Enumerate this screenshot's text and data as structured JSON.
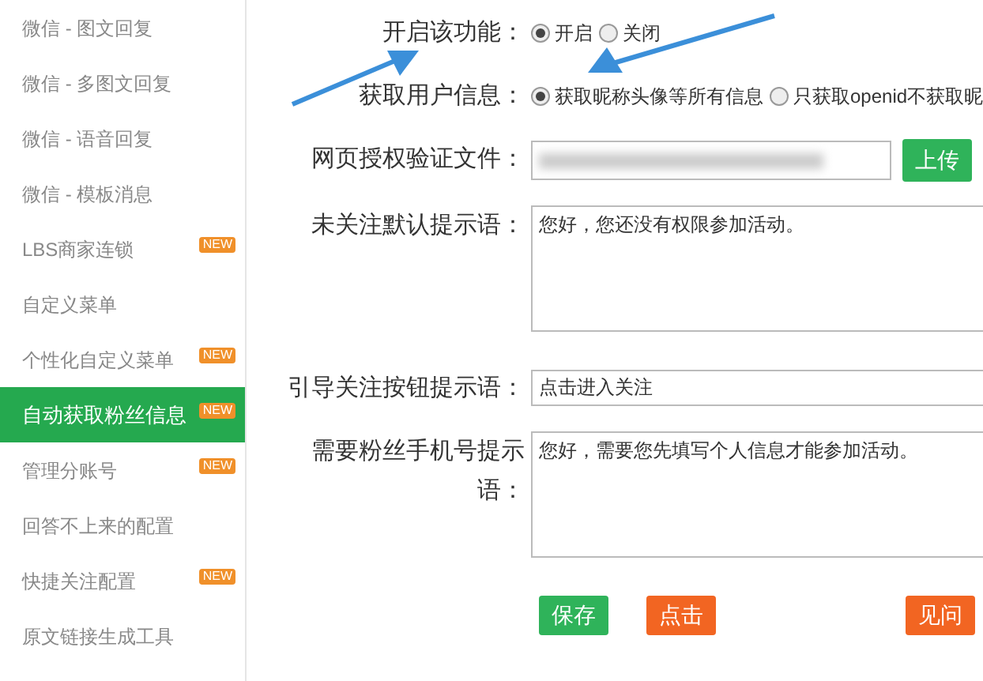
{
  "sidebar": {
    "items": [
      {
        "label": "微信 - 图文回复",
        "selected": false
      },
      {
        "label": "微信 - 多图文回复",
        "selected": false
      },
      {
        "label": "微信 - 语音回复",
        "selected": false
      },
      {
        "label": "微信 - 模板消息",
        "selected": false
      },
      {
        "label": "LBS商家连锁",
        "selected": false,
        "badge": "NEW"
      },
      {
        "label": "自定义菜单",
        "selected": false
      },
      {
        "label": "个性化自定义菜单",
        "selected": false,
        "badge": "NEW"
      },
      {
        "label": "自动获取粉丝信息",
        "selected": true,
        "badge": "NEW"
      },
      {
        "label": "管理分账号",
        "selected": false,
        "badge": "NEW"
      },
      {
        "label": "回答不上来的配置",
        "selected": false
      },
      {
        "label": "快捷关注配置",
        "selected": false,
        "badge": "NEW"
      },
      {
        "label": "原文链接生成工具",
        "selected": false
      }
    ]
  },
  "form": {
    "rows": [
      {
        "kind": "radio",
        "label": "开启该功能：",
        "options": [
          {
            "label": "开启",
            "selected": true
          },
          {
            "label": "关闭",
            "selected": false
          }
        ]
      },
      {
        "kind": "radio",
        "label": "获取用户信息：",
        "options": [
          {
            "label": "获取昵称头像等所有信息",
            "selected": true
          },
          {
            "label": "只获取openid不获取昵",
            "selected": false
          }
        ]
      },
      {
        "kind": "file",
        "label": "网页授权验证文件：",
        "button": "上传"
      },
      {
        "kind": "textarea",
        "label": "未关注默认提示语：",
        "value": "您好，您还没有权限参加活动。"
      },
      {
        "kind": "input",
        "label": "引导关注按钮提示语：",
        "value": "点击进入关注"
      },
      {
        "kind": "textarea",
        "label": "需要粉丝手机号提示语：",
        "value": "您好，需要您先填写个人信息才能参加活动。"
      }
    ],
    "buttons": [
      {
        "label": "保存",
        "kind": "primary"
      },
      {
        "label": "点击",
        "kind": "warning"
      },
      {
        "label": "见问",
        "kind": "warning"
      }
    ]
  }
}
